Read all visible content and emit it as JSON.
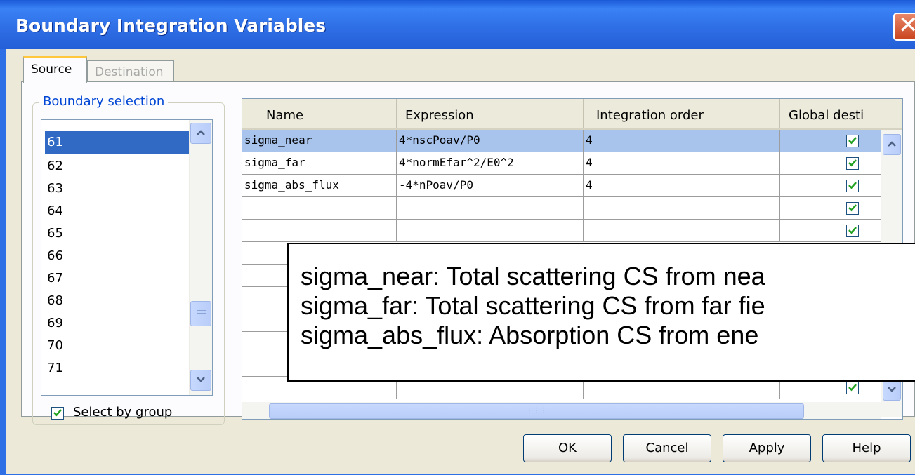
{
  "window": {
    "title": "Boundary Integration Variables",
    "close_glyph": "✕"
  },
  "tabs": [
    {
      "label": "Source",
      "active": true
    },
    {
      "label": "Destination",
      "active": false
    }
  ],
  "boundary": {
    "group_label": "Boundary selection",
    "items": [
      "61",
      "62",
      "63",
      "64",
      "65",
      "66",
      "67",
      "68",
      "69",
      "70",
      "71"
    ],
    "selected": "61",
    "select_by_group_label": "Select by group",
    "select_by_group_checked": true
  },
  "table": {
    "columns": [
      "Name",
      "Expression",
      "Integration order",
      "Global desti"
    ],
    "rows": [
      {
        "name": "sigma_near",
        "expression": "4*nscPoav/P0",
        "order": "4",
        "global": true
      },
      {
        "name": "sigma_far",
        "expression": "4*normEfar^2/E0^2",
        "order": "4",
        "global": true
      },
      {
        "name": "sigma_abs_flux",
        "expression": "-4*nPoav/P0",
        "order": "4",
        "global": true
      },
      {
        "name": "",
        "expression": "",
        "order": "",
        "global": true
      },
      {
        "name": "",
        "expression": "",
        "order": "",
        "global": true
      }
    ]
  },
  "buttons": {
    "ok": "OK",
    "cancel": "Cancel",
    "apply": "Apply",
    "help": "Help"
  },
  "callout": {
    "lines": [
      "sigma_near: Total scattering CS from nea",
      "sigma_far: Total scattering CS from far fie",
      "sigma_abs_flux: Absorption CS from ene"
    ]
  },
  "colors": {
    "titlebar": "#2f6fe6",
    "selection": "#316ac5",
    "dialog_bg": "#ece9d8"
  },
  "icons": {
    "scroll_up": "chevron-up-icon",
    "scroll_down": "chevron-down-icon",
    "check": "check-icon"
  }
}
